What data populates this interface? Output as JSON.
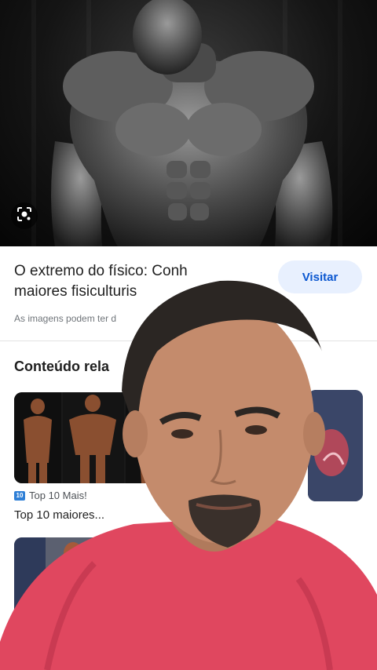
{
  "hero": {
    "lens_icon": "google-lens-icon",
    "image": "black-and-white photo of a bodybuilder"
  },
  "result": {
    "title_line1": "O extremo do físico: Conh",
    "title_line2": "maiores fisiculturis",
    "visit_label": "Visitar",
    "disclaimer": "As imagens podem ter d"
  },
  "related": {
    "heading": "Conteúdo rela",
    "items": [
      {
        "source": "Top 10 Mais!",
        "source_icon": "top10-icon",
        "title": "Top 10 maiores..."
      }
    ]
  },
  "overlay": {
    "image": "webcam of man in red t-shirt"
  },
  "colors": {
    "visit_bg": "#e8f0fe",
    "visit_text": "#0b57d0",
    "shirt": "#e0475f",
    "source_icon": "#2f7fd6"
  }
}
